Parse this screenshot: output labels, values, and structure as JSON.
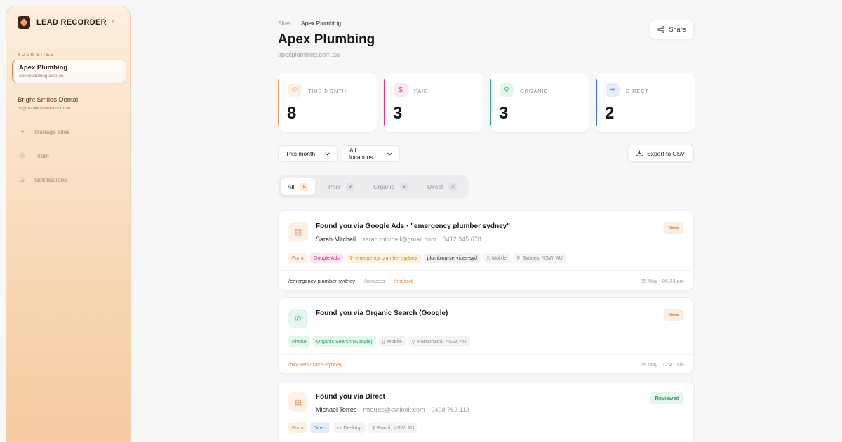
{
  "sidebar": {
    "brand": "LEAD RECORDER",
    "collapse_icon": "‹",
    "section_label": "YOUR SITES",
    "sites": [
      {
        "name": "Apex Plumbing",
        "url": "apexplumbing.com.au"
      },
      {
        "name": "Bright Smiles Dental",
        "url": "brightsmilesdental.com.au"
      }
    ],
    "nav": [
      {
        "label": "Manage sites",
        "icon": "+"
      },
      {
        "label": "Team",
        "icon": "⚇"
      },
      {
        "label": "Notifications",
        "icon": "♫"
      }
    ]
  },
  "header": {
    "crumb_root": "Sites",
    "crumb_current": "Apex Plumbing",
    "title": "Apex Plumbing",
    "url": "apexplumbing.com.au",
    "share_label": "Share"
  },
  "stats": [
    {
      "label": "THIS MONTH",
      "value": "8",
      "color": "#e8a06a",
      "tint": "#fdf1e6",
      "icon": "⚇"
    },
    {
      "label": "PAID",
      "value": "3",
      "color": "#d63b8c",
      "tint": "#fce7f1",
      "icon": "$"
    },
    {
      "label": "ORGANIC",
      "value": "3",
      "color": "#3bb07c",
      "tint": "#e5f6ec",
      "icon": "⚲"
    },
    {
      "label": "DIRECT",
      "value": "2",
      "color": "#3b78d6",
      "tint": "#e6eefc",
      "icon": "≋"
    }
  ],
  "filters": {
    "period": "This month",
    "location": "All locations",
    "export_label": "Export to CSV"
  },
  "tabs": [
    {
      "label": "All",
      "count": "8"
    },
    {
      "label": "Paid",
      "count": "3"
    },
    {
      "label": "Organic",
      "count": "3"
    },
    {
      "label": "Direct",
      "count": "2"
    }
  ],
  "leads": [
    {
      "title": "Found you via Google Ads · \"emergency plumber sydney\"",
      "name": "Sarah Mitchell",
      "email": "sarah.mitchell@gmail.com",
      "phone": "0412 345 678",
      "status": "New",
      "tags": [
        "Form",
        "Google Ads",
        "emergency plumber sydney",
        "plumbing-services-syd",
        "Mobile",
        "Sydney, NSW, AU"
      ],
      "paths": [
        "/emergency-plumber-sydney",
        "/services",
        "/contact"
      ],
      "time": "25 May · 06:23 pm"
    },
    {
      "title": "Found you via Organic Search (Google)",
      "status": "New",
      "tags": [
        "Phone",
        "Organic Search (Google)",
        "Mobile",
        "Parramatta, NSW, AU"
      ],
      "paths": [
        "/blocked-drains-sydney"
      ],
      "time": "25 May · 12:47 am"
    },
    {
      "title": "Found you via Direct",
      "name": "Michael Torres",
      "email": "mtorres@outlook.com",
      "phone": "0498 762 113",
      "status": "Reviewed",
      "tags": [
        "Form",
        "Direct",
        "Desktop",
        "Bondi, NSW, AU"
      ]
    }
  ]
}
